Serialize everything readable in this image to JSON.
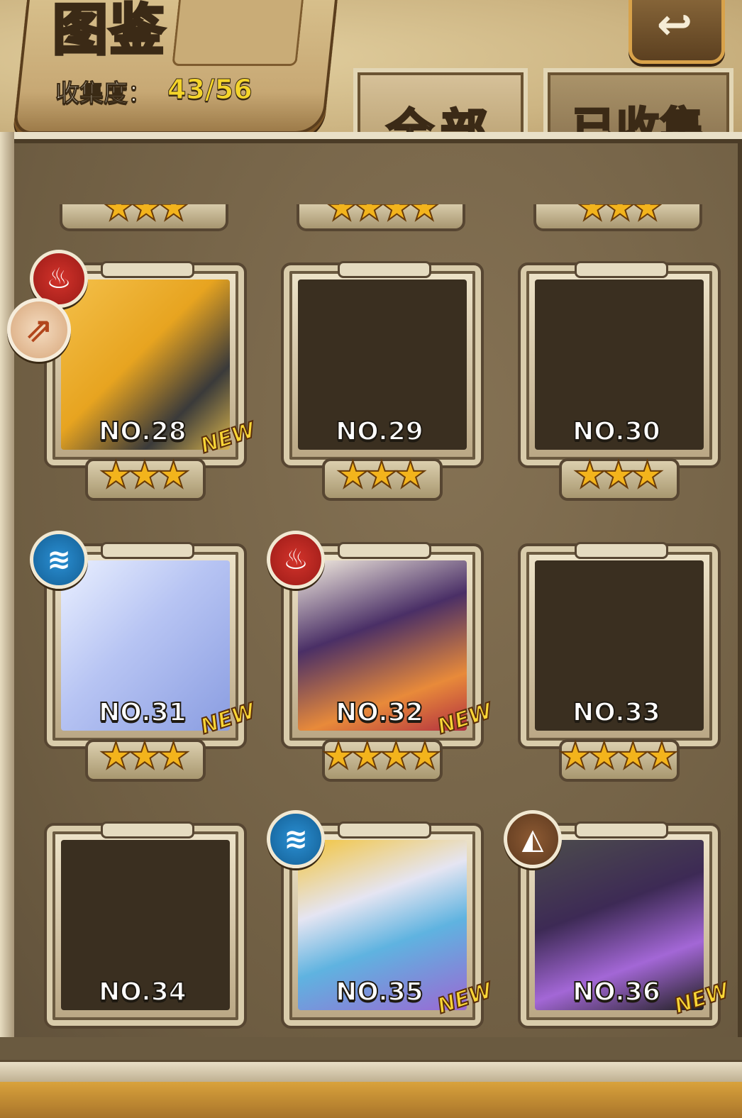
{
  "header": {
    "title": "图鉴",
    "collection_label": "收集度：",
    "collection_value": "43/56",
    "back_icon": "back-arrow-icon"
  },
  "tabs": [
    {
      "label": "全部",
      "active": true
    },
    {
      "label": "已收集",
      "active": false
    }
  ],
  "partial_row_stars": [
    "★★★",
    "★★★★",
    "★★★"
  ],
  "cards": [
    {
      "no": "NO.28",
      "stars": "★★★",
      "new": "NEW",
      "element": "fire"
    },
    {
      "no": "NO.29",
      "stars": "★★★",
      "element": null
    },
    {
      "no": "NO.30",
      "stars": "★★★",
      "element": null
    },
    {
      "no": "NO.31",
      "stars": "★★★",
      "new": "NEW",
      "element": "water"
    },
    {
      "no": "NO.32",
      "stars": "★★★★",
      "new": "NEW",
      "element": "fire"
    },
    {
      "no": "NO.33",
      "stars": "★★★★",
      "element": null
    },
    {
      "no": "NO.34",
      "stars": "",
      "element": null
    },
    {
      "no": "NO.35",
      "stars": "",
      "new": "NEW",
      "element": "water"
    },
    {
      "no": "NO.36",
      "stars": "",
      "new": "NEW",
      "element": "earth"
    }
  ],
  "element_icons": {
    "fire": "♨",
    "water": "≋",
    "earth": "◭"
  },
  "class_badge_icon": "⇗",
  "colors": {
    "gold": "#f4d42a",
    "star": "#f3b41c",
    "fire": "#d3332b",
    "water": "#2a8fd3",
    "earth": "#8d5a33"
  }
}
